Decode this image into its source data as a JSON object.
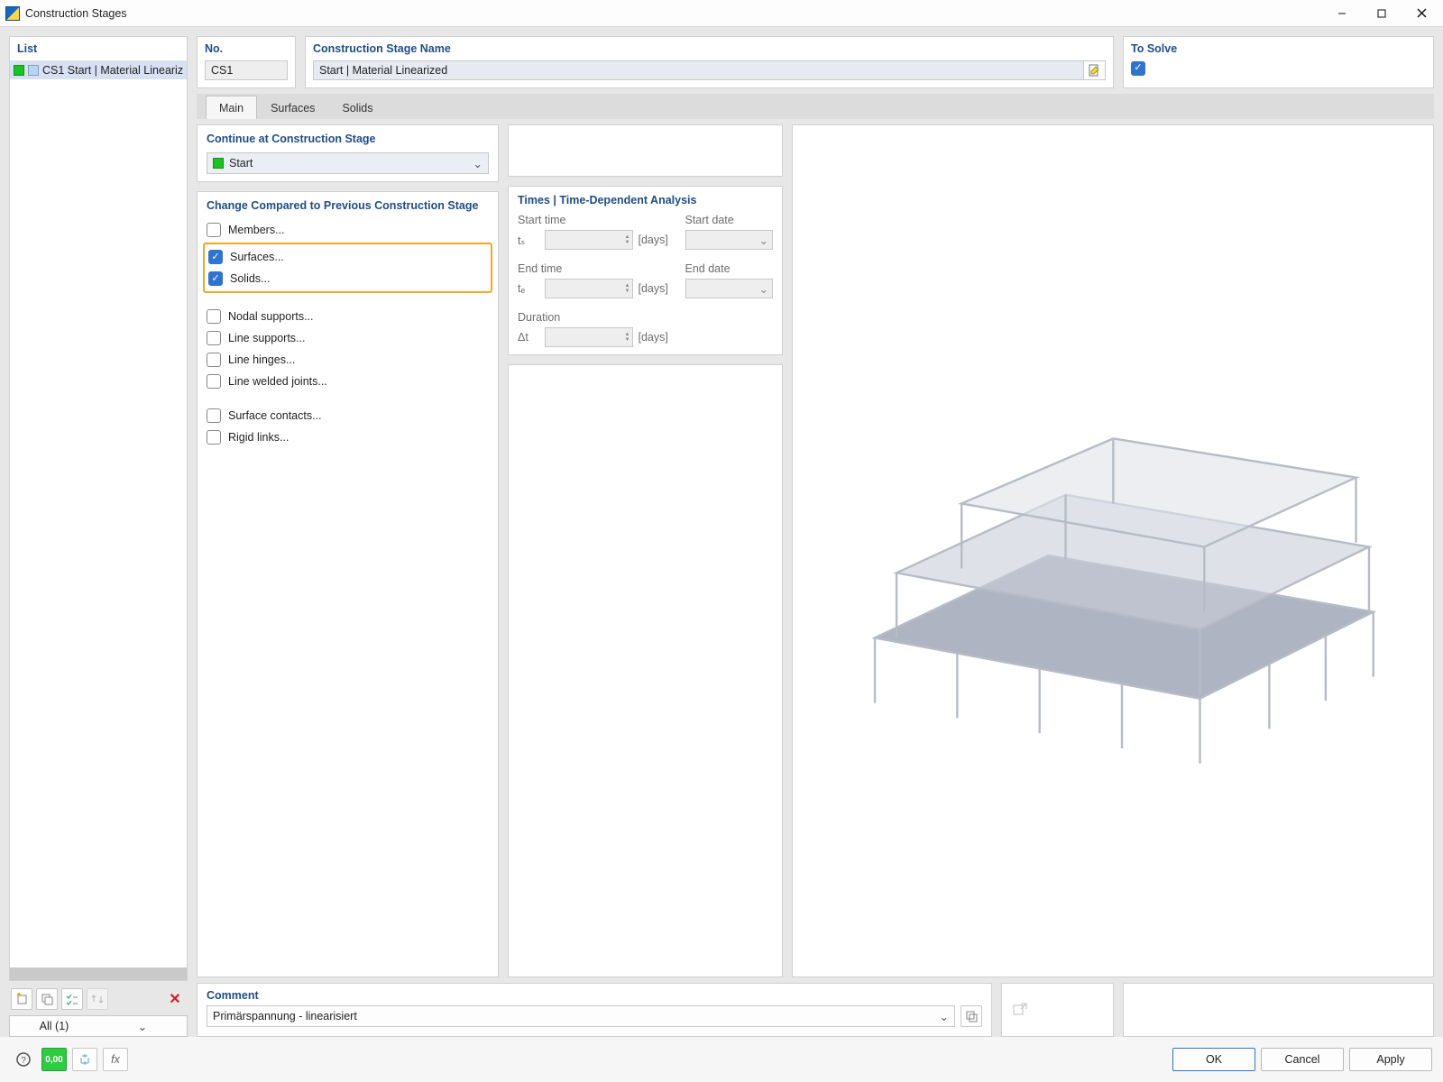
{
  "window": {
    "title": "Construction Stages"
  },
  "left": {
    "heading": "List",
    "items": [
      {
        "id": "CS1",
        "text": "CS1  Start | Material Lineariz"
      }
    ],
    "toolbar_filter": "All (1)"
  },
  "top": {
    "no_heading": "No.",
    "no_value": "CS1",
    "name_heading": "Construction Stage Name",
    "name_value": "Start | Material Linearized",
    "solve_heading": "To Solve",
    "solve_checked": true
  },
  "tabs": {
    "main": "Main",
    "surfaces": "Surfaces",
    "solids": "Solids",
    "active": "main"
  },
  "continue": {
    "heading": "Continue at Construction Stage",
    "value": "Start"
  },
  "change": {
    "heading": "Change Compared to Previous Construction Stage",
    "members": {
      "label": "Members...",
      "checked": false
    },
    "surfaces": {
      "label": "Surfaces...",
      "checked": true
    },
    "solids": {
      "label": "Solids...",
      "checked": true
    },
    "nodal_supports": {
      "label": "Nodal supports...",
      "checked": false
    },
    "line_supports": {
      "label": "Line supports...",
      "checked": false
    },
    "line_hinges": {
      "label": "Line hinges...",
      "checked": false
    },
    "line_welded": {
      "label": "Line welded joints...",
      "checked": false
    },
    "surface_contacts": {
      "label": "Surface contacts...",
      "checked": false
    },
    "rigid_links": {
      "label": "Rigid links...",
      "checked": false
    }
  },
  "times": {
    "heading": "Times | Time-Dependent Analysis",
    "start_time": "Start time",
    "start_date": "Start date",
    "end_time": "End time",
    "end_date": "End date",
    "duration": "Duration",
    "ts": "tₛ",
    "te": "tₑ",
    "dt": "Δt",
    "days": "[days]"
  },
  "comment": {
    "heading": "Comment",
    "value": "Primärspannung - linearisiert"
  },
  "footer": {
    "ok": "OK",
    "cancel": "Cancel",
    "apply": "Apply"
  },
  "footer_icons": {
    "units_label": "0,00"
  }
}
